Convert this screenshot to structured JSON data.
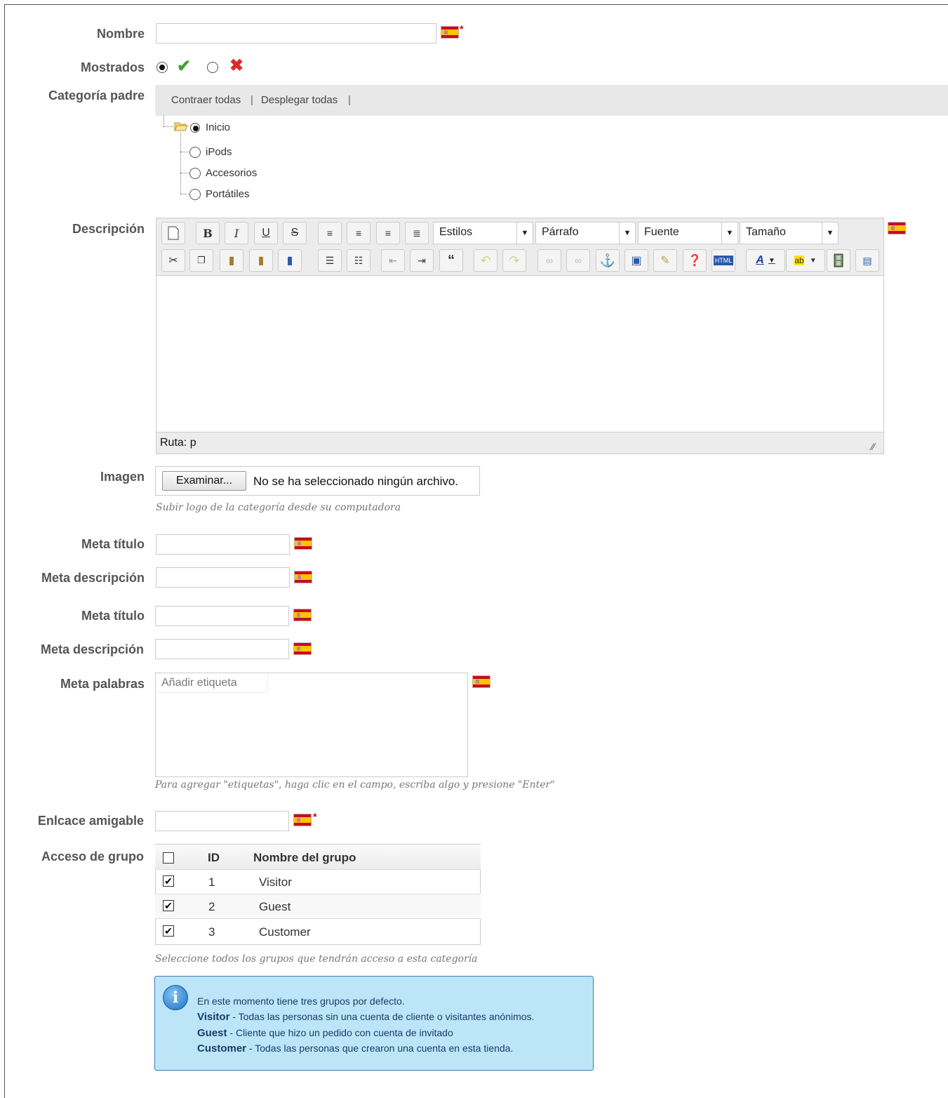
{
  "form": {
    "name_label": "Nombre",
    "name_value": "",
    "displayed_label": "Mostrados",
    "parent_label": "Categoría padre",
    "tree_actions": {
      "collapse": "Contraer todas",
      "expand": "Desplegar todas",
      "sep": "|"
    },
    "tree": [
      "Inicio",
      "iPods",
      "Accesorios",
      "Portátiles"
    ],
    "description_label": "Descripción",
    "editor": {
      "styles": "Estilos",
      "paragraph": "Párrafo",
      "font": "Fuente",
      "size": "Tamaño",
      "path": "Ruta: p"
    },
    "image_label": "Imagen",
    "browse_button": "Examinar...",
    "no_file": "No se ha seleccionado ningún archivo.",
    "image_hint": "Subir logo de la categoría desde su computadora",
    "meta_title_label": "Meta título",
    "meta_desc_label": "Meta descripción",
    "meta_keywords_label": "Meta palabras",
    "tag_placeholder": "Añadir etiqueta",
    "keywords_hint": "Para agregar \"etiquetas\", haga clic en el campo, escriba algo y presione \"Enter\"",
    "friendly_url_label": "Enlcace amigable",
    "group_access_label": "Acceso de grupo",
    "groups_header": {
      "id": "ID",
      "name": "Nombre del grupo"
    },
    "groups": [
      {
        "id": "1",
        "name": "Visitor",
        "checked": true
      },
      {
        "id": "2",
        "name": "Guest",
        "checked": true
      },
      {
        "id": "3",
        "name": "Customer",
        "checked": true
      }
    ],
    "groups_hint": "Seleccione todos los grupos que tendrán acceso a esta categoría",
    "required_mark": "*"
  },
  "info": {
    "intro": "En este momento tiene tres grupos por defecto.",
    "lines": [
      {
        "name": "Visitor",
        "text": " - Todas las personas sin una cuenta de cliente o visitantes anónimos."
      },
      {
        "name": "Guest",
        "text": " - Cliente que hizo un pedido con cuenta de invitado"
      },
      {
        "name": "Customer",
        "text": " - Todas las personas que crearon una cuenta en esta tienda."
      }
    ]
  },
  "colors": {
    "check_green": "#4a9e2a",
    "cross_red": "#e02a2a",
    "info_bg": "#bde5f8",
    "info_border": "#3a7bbd"
  }
}
